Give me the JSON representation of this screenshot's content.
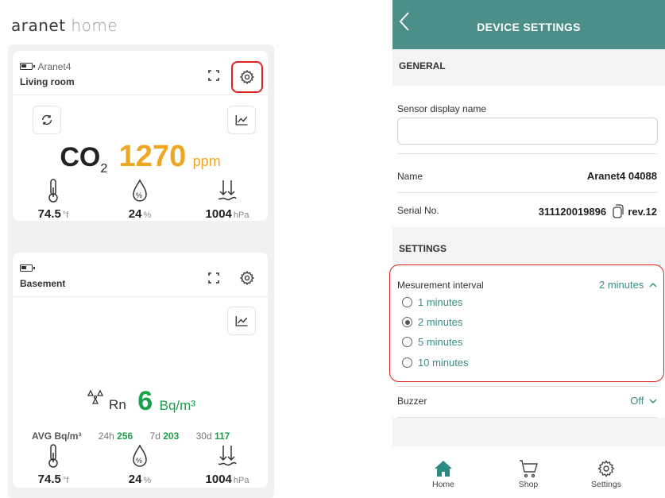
{
  "brand": {
    "part1": "aranet",
    "part2": "home"
  },
  "card1": {
    "device": "Aranet4",
    "location": "Living room",
    "co2_label": "CO",
    "co2_sub": "2",
    "co2_value": "1270",
    "co2_unit": "ppm",
    "temp_value": "74.5",
    "temp_unit": "°f",
    "hum_value": "24",
    "hum_unit": "%",
    "press_value": "1004",
    "press_unit": "hPa"
  },
  "card2": {
    "location": "Basement",
    "rn_symbol": "Rn",
    "rn_value": "6",
    "rn_unit": "Bq/m³",
    "avg_label": "AVG Bq/m³",
    "avg": [
      {
        "period": "24h",
        "value": "256"
      },
      {
        "period": "7d",
        "value": "203"
      },
      {
        "period": "30d",
        "value": "117"
      }
    ],
    "temp_value": "74.5",
    "temp_unit": "°f",
    "hum_value": "24",
    "hum_unit": "%",
    "press_value": "1004",
    "press_unit": "hPa"
  },
  "settings": {
    "title": "DEVICE SETTINGS",
    "general_header": "GENERAL",
    "display_name_label": "Sensor display name",
    "display_name_value": "",
    "name_label": "Name",
    "name_value": "Aranet4 04088",
    "serial_label": "Serial No.",
    "serial_value": "311120019896",
    "revision": "rev.12",
    "settings_header": "SETTINGS",
    "interval_label": "Mesurement interval",
    "interval_value": "2 minutes",
    "interval_options": [
      "1 minutes",
      "2 minutes",
      "5 minutes",
      "10 minutes"
    ],
    "interval_selected": "2 minutes",
    "buzzer_label": "Buzzer",
    "buzzer_value": "Off"
  },
  "nav": {
    "home": "Home",
    "shop": "Shop",
    "settings": "Settings"
  },
  "colors": {
    "teal": "#4c8f88",
    "co2_warning": "#f0a623",
    "radon_good": "#1aa04a",
    "highlight": "#dd2222"
  }
}
